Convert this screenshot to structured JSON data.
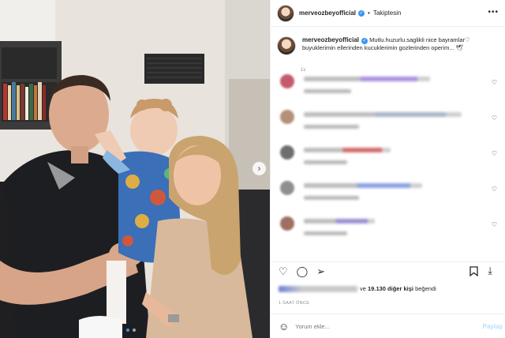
{
  "post": {
    "username": "merveozbeyofficial",
    "separator": "•",
    "follow_status": "Takiptesin",
    "more_label": "•••",
    "caption": "Mutlu.huzurlu.saglikli nice bayramlar♡ buyuklerimin ellerinden kucuklerimin gozlerinden operim... 🕊",
    "caption_age": "1s",
    "image_label": "Aile fotoğrafı",
    "next_label": "›",
    "carousel_pages": 2,
    "carousel_active": 0
  },
  "comments": [
    {
      "avatar_color": "#c45a6a",
      "line_color": "#a98fe0",
      "line_width": 160,
      "sub_width": 60
    },
    {
      "avatar_color": "#b48f7a",
      "line_color": "#a9b5c8",
      "line_width": 200,
      "sub_width": 70
    },
    {
      "avatar_color": "#6e6e6e",
      "line_color": "#d26b6b",
      "line_width": 110,
      "sub_width": 55
    },
    {
      "avatar_color": "#8f8f8f",
      "line_color": "#8aa0e4",
      "line_width": 150,
      "sub_width": 70
    },
    {
      "avatar_color": "#a06f63",
      "line_color": "#9a8fd4",
      "line_width": 90,
      "sub_width": 55
    }
  ],
  "icons": {
    "heart": "♡",
    "comment": "◯",
    "share": "➢",
    "bookmark": "🔖",
    "download": "⤓",
    "emoji": "☺"
  },
  "likes": {
    "prefix": "ve",
    "count": "19.130 diğer kişi",
    "suffix": "beğendi"
  },
  "timestamp": "1 SAAT ÖNCE",
  "comment_box": {
    "placeholder": "Yorum ekle...",
    "post_label": "Paylaş"
  },
  "colors": {
    "accent": "#3897f0",
    "post_disabled": "#b2dffc"
  }
}
